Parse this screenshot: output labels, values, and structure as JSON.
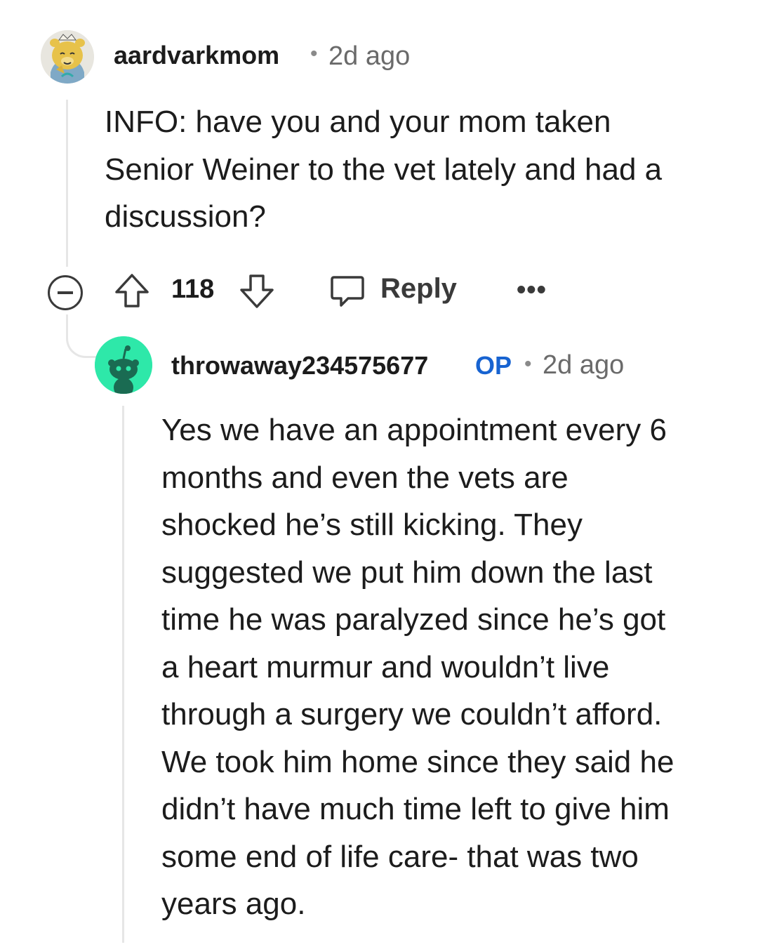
{
  "comment": {
    "username": "aardvarkmom",
    "separator": "•",
    "time": "2d ago",
    "body": "INFO: have you and your mom taken\nSenior Weiner to the vet lately and had a\ndiscussion?",
    "score": "118",
    "reply_label": "Reply",
    "more_label": "•••",
    "avatar_icon": "cartoon-bear-avatar-icon"
  },
  "reply": {
    "username": "throwaway234575677",
    "op_badge": "OP",
    "separator": "•",
    "time": "2d ago",
    "body": "Yes we have an appointment every 6\nmonths and even the vets are\nshocked he’s still kicking. They\nsuggested we put him down the last\ntime he was paralyzed since he’s got\na heart murmur and wouldn’t live\nthrough a surgery we couldn’t afford.\nWe took him home since they said he\ndidn’t have much time left to give him\nsome end of life care- that was two\nyears ago.",
    "avatar_icon": "reddit-snoo-avatar-icon",
    "avatar_color": "#2ee8a9"
  }
}
